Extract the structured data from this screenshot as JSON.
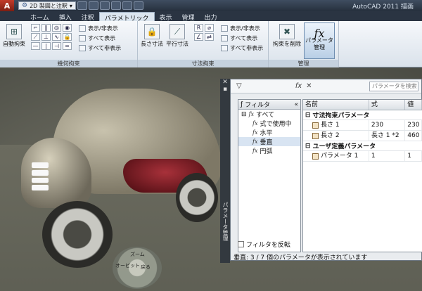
{
  "titlebar": {
    "workspace": "2D 製図と注釈",
    "app_title": "AutoCAD 2011  描画"
  },
  "tabs": [
    "ホーム",
    "挿入",
    "注釈",
    "パラメトリック",
    "表示",
    "管理",
    "出力"
  ],
  "ribbon": {
    "geometric": {
      "title": "幾何拘束",
      "auto_constrain": "自動拘束",
      "show_hide": "表示/非表示",
      "show_all": "すべて表示",
      "hide_all": "すべて非表示"
    },
    "dimensional": {
      "title": "寸法拘束",
      "linear": "長さ寸法",
      "aligned": "平行寸法",
      "show_hide": "表示/非表示",
      "show_all": "すべて表示",
      "hide_all": "すべて非表示"
    },
    "manage": {
      "title": "管理",
      "delete_constraints": "拘束を削除",
      "parameters_manager": "パラメータ管理"
    }
  },
  "viewport": {
    "nav_wheel_labels": [
      "ズーム",
      "オービット",
      "戻る"
    ],
    "side_label": "パラメータ管理"
  },
  "param_manager": {
    "search_placeholder": "パラメータを検索",
    "filter": {
      "header": "フィルタ",
      "items": [
        "すべて",
        "式で使用中",
        "水平",
        "垂直",
        "円弧"
      ],
      "invert": "フィルタを反転"
    },
    "grid": {
      "columns": [
        "名前",
        "式",
        "値"
      ],
      "groups": [
        {
          "name": "寸法拘束パラメータ",
          "rows": [
            {
              "name": "長さ 1",
              "expression": "230",
              "value": "230"
            },
            {
              "name": "長さ 2",
              "expression": "長さ 1 *2",
              "value": "460"
            }
          ]
        },
        {
          "name": "ユーザ定義パラメータ",
          "rows": [
            {
              "name": "パラメータ 1",
              "expression": "1",
              "value": "1"
            }
          ]
        }
      ]
    },
    "status": "垂直: 3 / 7 個のパラメータが表示されています"
  }
}
